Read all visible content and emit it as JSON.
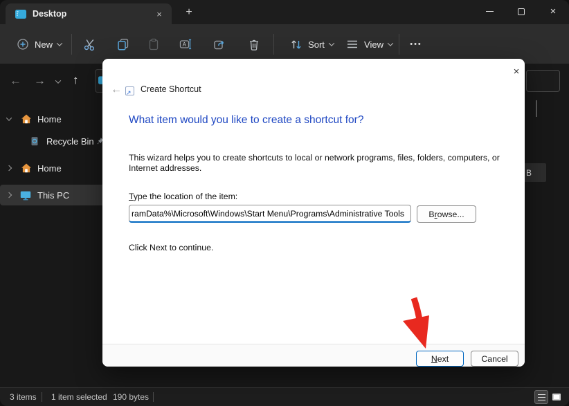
{
  "titlebar": {
    "tab_title": "Desktop",
    "tab_close": "×",
    "new_tab": "+",
    "close": "×"
  },
  "toolbar": {
    "new_label": "New",
    "sort_label": "Sort",
    "view_label": "View",
    "more_label": "•••",
    "icons": [
      "new-plus-icon",
      "cut-icon",
      "copy-icon",
      "paste-icon",
      "rename-icon",
      "share-icon",
      "delete-icon",
      "sort-arrows-icon",
      "view-lines-icon",
      "more-ellipsis-icon"
    ]
  },
  "sidebar": {
    "items": [
      {
        "label": "Home",
        "icon": "home-icon",
        "expanded": true
      },
      {
        "label": "Recycle Bin",
        "icon": "recycle-bin-icon",
        "pinned": true
      },
      {
        "label": "Home",
        "icon": "home-icon"
      },
      {
        "label": "This PC",
        "icon": "this-pc-icon",
        "selected": true
      }
    ]
  },
  "dialog": {
    "title": "Create Shortcut",
    "close": "×",
    "back": "←",
    "shortcut_icon_arrow": "↗",
    "heading": "What item would you like to create a shortcut for?",
    "description_line1": "This wizard helps you to create shortcuts to local or network programs, files, folders, computers, or",
    "description_line2": "Internet addresses.",
    "location_label": {
      "key": "T",
      "rest": "ype the location of the item:"
    },
    "location_value": "ramData%\\Microsoft\\Windows\\Start Menu\\Programs\\Administrative Tools",
    "browse": {
      "pre": "B",
      "key": "r",
      "rest": "owse..."
    },
    "hint": "Click Next to continue.",
    "next": {
      "key": "N",
      "rest": "ext"
    },
    "cancel": "Cancel"
  },
  "background": {
    "size_fragment": "B"
  },
  "statusbar": {
    "count": "3 items",
    "selected": "1 item selected",
    "size": "190 bytes"
  },
  "colors": {
    "accent": "#0067c0",
    "heading_blue": "#1d46c2",
    "annotation_red": "#e8291f",
    "icon_blue": "#5aa7dd"
  }
}
